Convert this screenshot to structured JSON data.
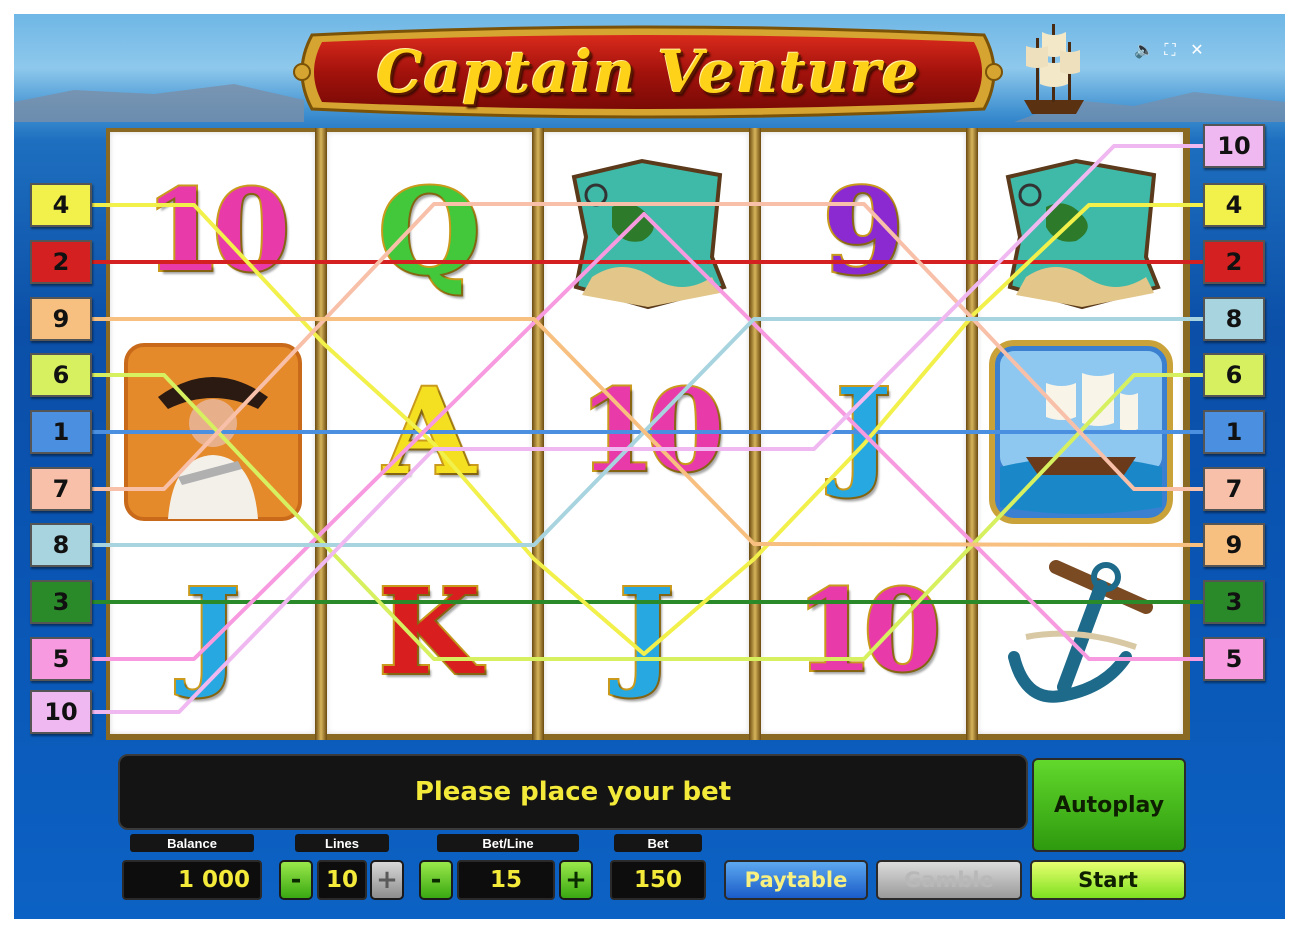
{
  "game_title": "Captain Venture",
  "top_controls": {
    "sound_icon": "speaker-icon",
    "fullscreen_icon": "fullscreen-icon",
    "close_icon": "close-icon",
    "close_glyph": "✕",
    "sound_glyph": "🔈",
    "fullscreen_glyph": "⛶"
  },
  "reels": [
    [
      "10",
      "captain",
      "J"
    ],
    [
      "Q",
      "A",
      "K"
    ],
    [
      "map",
      "10",
      "J"
    ],
    [
      "9",
      "J",
      "10"
    ],
    [
      "map",
      "ship",
      "anchor"
    ]
  ],
  "paylines": {
    "left": [
      "4",
      "2",
      "9",
      "6",
      "1",
      "7",
      "8",
      "3",
      "5",
      "10"
    ],
    "right": [
      "10",
      "4",
      "2",
      "8",
      "6",
      "1",
      "7",
      "9",
      "3",
      "5"
    ],
    "colors": {
      "1": "#4a8fe0",
      "2": "#d42020",
      "3": "#2a8a2a",
      "4": "#f2f04a",
      "5": "#f79ae0",
      "6": "#d6f060",
      "7": "#f8c0a8",
      "8": "#a8d4e0",
      "9": "#f8c080",
      "10": "#f0b8f0"
    }
  },
  "message": "Please place your bet",
  "controls": {
    "balance_label": "Balance",
    "balance_value": "1 000",
    "lines_label": "Lines",
    "lines_value": "10",
    "betline_label": "Bet/Line",
    "betline_value": "15",
    "bet_label": "Bet",
    "bet_value": "150",
    "minus": "-",
    "plus": "+",
    "paytable_label": "Paytable",
    "gamble_label": "Gamble",
    "autoplay_label": "Autoplay",
    "start_label": "Start"
  }
}
